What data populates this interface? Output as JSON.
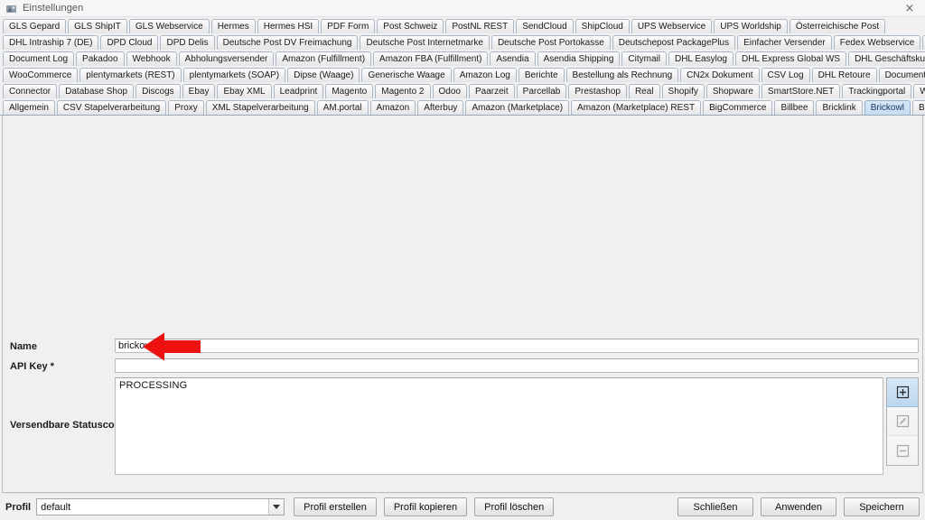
{
  "window": {
    "title": "Einstellungen",
    "icon": "app-icon",
    "close_label": "×"
  },
  "tabs": {
    "rows": [
      [
        {
          "label": "GLS Gepard",
          "selected": false
        },
        {
          "label": "GLS ShipIT",
          "selected": false
        },
        {
          "label": "GLS Webservice",
          "selected": false
        },
        {
          "label": "Hermes",
          "selected": false
        },
        {
          "label": "Hermes HSI",
          "selected": false
        },
        {
          "label": "PDF Form",
          "selected": false
        },
        {
          "label": "Post Schweiz",
          "selected": false
        },
        {
          "label": "PostNL REST",
          "selected": false
        },
        {
          "label": "SendCloud",
          "selected": false
        },
        {
          "label": "ShipCloud",
          "selected": false
        },
        {
          "label": "UPS Webservice",
          "selected": false
        },
        {
          "label": "UPS Worldship",
          "selected": false
        },
        {
          "label": "Österreichische Post",
          "selected": false
        }
      ],
      [
        {
          "label": "DHL Intraship 7 (DE)",
          "selected": false
        },
        {
          "label": "DPD Cloud",
          "selected": false
        },
        {
          "label": "DPD Delis",
          "selected": false
        },
        {
          "label": "Deutsche Post DV Freimachung",
          "selected": false
        },
        {
          "label": "Deutsche Post Internetmarke",
          "selected": false
        },
        {
          "label": "Deutsche Post Portokasse",
          "selected": false
        },
        {
          "label": "Deutschepost PackagePlus",
          "selected": false
        },
        {
          "label": "Einfacher Versender",
          "selected": false
        },
        {
          "label": "Fedex Webservice",
          "selected": false
        },
        {
          "label": "GEL Express",
          "selected": false
        }
      ],
      [
        {
          "label": "Document Log",
          "selected": false
        },
        {
          "label": "Pakadoo",
          "selected": false
        },
        {
          "label": "Webhook",
          "selected": false
        },
        {
          "label": "Abholungsversender",
          "selected": false
        },
        {
          "label": "Amazon (Fulfillment)",
          "selected": false
        },
        {
          "label": "Amazon FBA (Fulfillment)",
          "selected": false
        },
        {
          "label": "Asendia",
          "selected": false
        },
        {
          "label": "Asendia Shipping",
          "selected": false
        },
        {
          "label": "Citymail",
          "selected": false
        },
        {
          "label": "DHL Easylog",
          "selected": false
        },
        {
          "label": "DHL Express Global WS",
          "selected": false
        },
        {
          "label": "DHL Geschäftskundenversand",
          "selected": false
        }
      ],
      [
        {
          "label": "WooCommerce",
          "selected": false
        },
        {
          "label": "plentymarkets (REST)",
          "selected": false
        },
        {
          "label": "plentymarkets (SOAP)",
          "selected": false
        },
        {
          "label": "Dipse (Waage)",
          "selected": false
        },
        {
          "label": "Generische Waage",
          "selected": false
        },
        {
          "label": "Amazon Log",
          "selected": false
        },
        {
          "label": "Berichte",
          "selected": false
        },
        {
          "label": "Bestellung als Rechnung",
          "selected": false
        },
        {
          "label": "CN2x Dokument",
          "selected": false
        },
        {
          "label": "CSV Log",
          "selected": false
        },
        {
          "label": "DHL Retoure",
          "selected": false
        },
        {
          "label": "Document Downloader",
          "selected": false
        }
      ],
      [
        {
          "label": "Connector",
          "selected": false
        },
        {
          "label": "Database Shop",
          "selected": false
        },
        {
          "label": "Discogs",
          "selected": false
        },
        {
          "label": "Ebay",
          "selected": false
        },
        {
          "label": "Ebay XML",
          "selected": false
        },
        {
          "label": "Leadprint",
          "selected": false
        },
        {
          "label": "Magento",
          "selected": false
        },
        {
          "label": "Magento 2",
          "selected": false
        },
        {
          "label": "Odoo",
          "selected": false
        },
        {
          "label": "Paarzeit",
          "selected": false
        },
        {
          "label": "Parcellab",
          "selected": false
        },
        {
          "label": "Prestashop",
          "selected": false
        },
        {
          "label": "Real",
          "selected": false
        },
        {
          "label": "Shopify",
          "selected": false
        },
        {
          "label": "Shopware",
          "selected": false
        },
        {
          "label": "SmartStore.NET",
          "selected": false
        },
        {
          "label": "Trackingportal",
          "selected": false
        },
        {
          "label": "Weclapp",
          "selected": false
        }
      ],
      [
        {
          "label": "Allgemein",
          "selected": false
        },
        {
          "label": "CSV Stapelverarbeitung",
          "selected": false
        },
        {
          "label": "Proxy",
          "selected": false
        },
        {
          "label": "XML Stapelverarbeitung",
          "selected": false
        },
        {
          "label": "AM.portal",
          "selected": false
        },
        {
          "label": "Amazon",
          "selected": false
        },
        {
          "label": "Afterbuy",
          "selected": false
        },
        {
          "label": "Amazon (Marketplace)",
          "selected": false
        },
        {
          "label": "Amazon (Marketplace) REST",
          "selected": false
        },
        {
          "label": "BigCommerce",
          "selected": false
        },
        {
          "label": "Billbee",
          "selected": false
        },
        {
          "label": "Bricklink",
          "selected": false
        },
        {
          "label": "Brickowl",
          "selected": true
        },
        {
          "label": "Brickscout",
          "selected": false
        }
      ]
    ]
  },
  "form": {
    "name": {
      "label": "Name",
      "value": "brickowl",
      "placeholder": ""
    },
    "api_key": {
      "label": "API Key *",
      "value": "",
      "placeholder": ""
    },
    "statuscodes": {
      "label": "Versendbare Statuscodes *",
      "items": [
        "PROCESSING"
      ]
    },
    "list_buttons": [
      {
        "name": "add-status-button",
        "icon": "plus-box-icon",
        "state": "active"
      },
      {
        "name": "edit-status-button",
        "icon": "pencil-box-icon",
        "state": "disabled"
      },
      {
        "name": "remove-status-button",
        "icon": "minus-box-icon",
        "state": "disabled"
      }
    ],
    "annotation": {
      "type": "red-arrow-left",
      "color": "#ee1111"
    }
  },
  "bottom": {
    "profile_label": "Profil",
    "profile_value": "default",
    "profile_buttons": [
      {
        "label": "Profil erstellen",
        "name": "create-profile-button"
      },
      {
        "label": "Profil kopieren",
        "name": "copy-profile-button"
      },
      {
        "label": "Profil löschen",
        "name": "delete-profile-button"
      }
    ],
    "action_buttons": [
      {
        "label": "Schließen",
        "name": "close-button"
      },
      {
        "label": "Anwenden",
        "name": "apply-button"
      },
      {
        "label": "Speichern",
        "name": "save-button"
      }
    ]
  }
}
